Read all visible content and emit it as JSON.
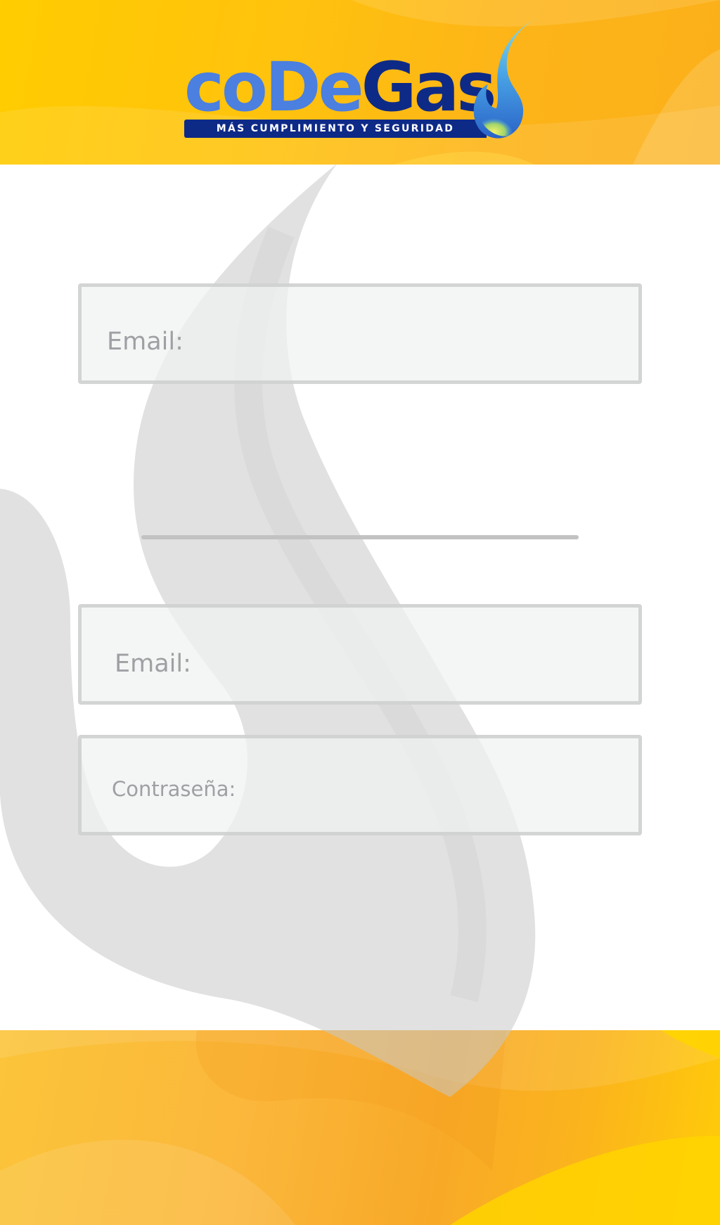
{
  "brand": {
    "name_part_1": "coDe",
    "name_part_2": "Gas",
    "tagline": "MÁS CUMPLIMIENTO Y SEGURIDAD"
  },
  "form": {
    "email_top_placeholder": "Email:",
    "email_placeholder": "Email:",
    "password_placeholder": "Contraseña:"
  },
  "colors": {
    "brand_yellow": "#ffc20e",
    "brand_orange": "#fbb01a",
    "logo_light_blue": "#4b7fe0",
    "logo_dark_blue": "#0e2a87",
    "field_background": "#f2f3f3",
    "field_border": "#d6d6d6",
    "placeholder_text": "#9fa0a3"
  },
  "icons": {
    "logo_flame": "flame-icon",
    "background": "flame-watermark"
  }
}
